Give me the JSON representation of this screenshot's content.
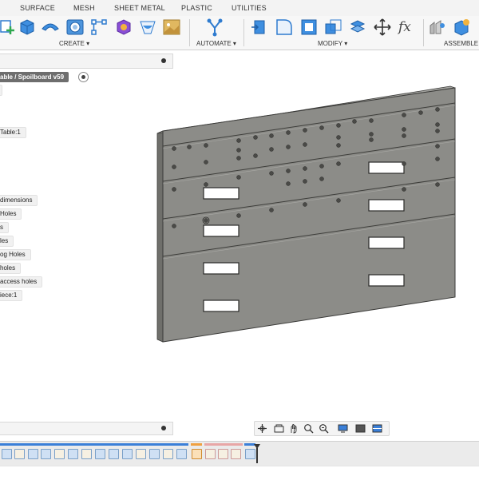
{
  "tabs": [
    "SURFACE",
    "MESH",
    "SHEET METAL",
    "PLASTIC",
    "UTILITIES"
  ],
  "toolbar_groups": {
    "create": "CREATE ▾",
    "automate": "AUTOMATE ▾",
    "modify": "MODIFY ▾",
    "assemble": "ASSEMBLE"
  },
  "browser": {
    "component_path": "able / Spoilboard v59",
    "items": [
      "Table:1",
      "dimensions",
      "Holes",
      "s",
      "les",
      "og Holes",
      "holes",
      "access holes",
      "iece:1"
    ]
  },
  "icons": {
    "function": "fx"
  },
  "colors": {
    "accent_blue": "#2e7bcf",
    "part_gray": "#8a8a86",
    "timeline_blue": "#3a7fd8",
    "timeline_pink": "#e8a6a6",
    "timeline_orange": "#f0a040"
  }
}
